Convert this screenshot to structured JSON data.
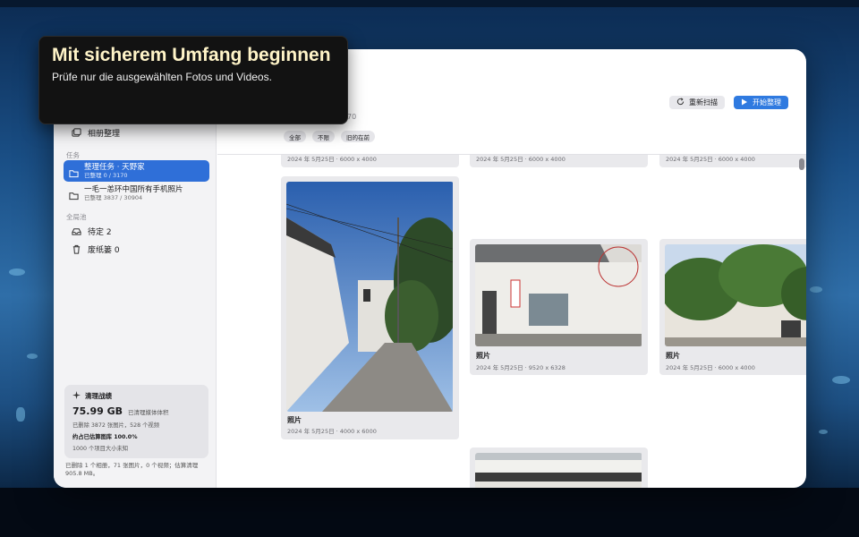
{
  "coach": {
    "title": "Mit sicherem Umfang beginnen",
    "body": "Prüfe nur die ausgewählten Fotos und Videos."
  },
  "sidebar": {
    "album_cleanup": {
      "label": "相册整理",
      "icon": "album-stack-icon"
    },
    "tasks_section": "任务",
    "tasks": [
      {
        "title": "整理任务 · 天野家",
        "progress": "已整理 0 / 3170",
        "active": true,
        "icon": "folder-icon"
      },
      {
        "title": "一毛一恙环中国所有手机照片",
        "progress": "已整理 3837 / 30904",
        "active": false,
        "icon": "folder-icon"
      }
    ],
    "global_section": "全局池",
    "global_items": [
      {
        "label": "待定 2",
        "icon": "tray-icon"
      },
      {
        "label": "废纸篓 0",
        "icon": "trash-icon"
      }
    ],
    "stats": {
      "title": "清理战绩",
      "amount": "75.99 GB",
      "amount_label": "已清理媒体体积",
      "deleted": "已删除 3872 张图片，528 个视频",
      "estimate": "约占已估算图库 100.0%",
      "unknown": "1000 个项目大小未知"
    },
    "footer": "已删除 1 个相册，71 张图片，0 个视频；估算清理 905.8 MB。"
  },
  "toolbar": {
    "rescan_label": "重新扫描",
    "start_label": "开始整理",
    "subtitle_fragment": "70",
    "accent": "#2f7ae0"
  },
  "filters": [
    "全部",
    "不限",
    "旧的在前"
  ],
  "grid": {
    "top_row_meta": [
      "2024 年 5月25日 · 6000 x 4000",
      "2024 年 5月25日 · 6000 x 4000",
      "2024 年 5月25日 · 6000 x 4000"
    ],
    "cards": [
      {
        "title": "照片",
        "meta": "2024 年 5月25日 · 4000 x 6000"
      },
      {
        "title": "照片",
        "meta": "2024 年 5月25日 · 9520 x 6328"
      },
      {
        "title": "照片",
        "meta": "2024 年 5月25日 · 6000 x 4000"
      }
    ]
  }
}
